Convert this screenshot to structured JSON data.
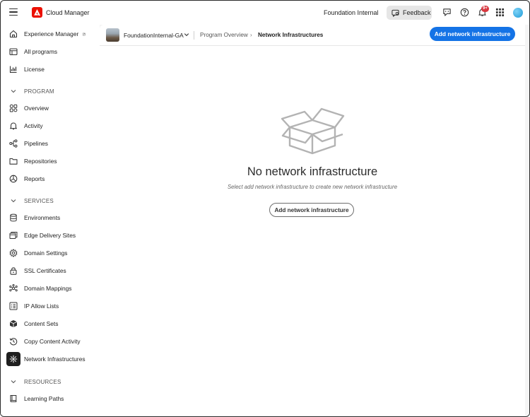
{
  "app": {
    "title": "Cloud Manager",
    "org_name": "Foundation Internal",
    "feedback_label": "Feedback",
    "notification_count": "9+",
    "brand_color": "#eb1000",
    "accent_color": "#1473e6"
  },
  "sidebar": {
    "top_items": [
      {
        "label": "Experience Manager",
        "icon": "home-icon"
      },
      {
        "label": "All programs",
        "icon": "programs-icon"
      },
      {
        "label": "License",
        "icon": "license-icon"
      }
    ],
    "sections": [
      {
        "title": "PROGRAM",
        "items": [
          {
            "label": "Overview",
            "icon": "overview-icon"
          },
          {
            "label": "Activity",
            "icon": "bell-icon"
          },
          {
            "label": "Pipelines",
            "icon": "pipelines-icon"
          },
          {
            "label": "Repositories",
            "icon": "folder-icon"
          },
          {
            "label": "Reports",
            "icon": "pie-chart-icon"
          }
        ]
      },
      {
        "title": "SERVICES",
        "items": [
          {
            "label": "Environments",
            "icon": "database-icon"
          },
          {
            "label": "Edge Delivery Sites",
            "icon": "sites-icon"
          },
          {
            "label": "Domain Settings",
            "icon": "settings-icon"
          },
          {
            "label": "SSL Certificates",
            "icon": "lock-icon"
          },
          {
            "label": "Domain Mappings",
            "icon": "mapping-icon"
          },
          {
            "label": "IP Allow Lists",
            "icon": "list-icon"
          },
          {
            "label": "Content Sets",
            "icon": "boxes-icon"
          },
          {
            "label": "Copy Content Activity",
            "icon": "history-icon"
          },
          {
            "label": "Network Infrastructures",
            "icon": "network-icon",
            "active": true
          }
        ]
      },
      {
        "title": "RESOURCES",
        "items": [
          {
            "label": "Learning Paths",
            "icon": "book-icon"
          }
        ]
      }
    ]
  },
  "header": {
    "program_name": "FoundationInternal-GA",
    "breadcrumb": [
      "Program Overview",
      "Network Infrastructures"
    ],
    "breadcrumb_separator": "›",
    "primary_action": "Add network infrastructure"
  },
  "empty_state": {
    "title": "No network infrastructure",
    "subtitle": "Select add network infrastructure to create new network infrastructure",
    "action_label": "Add network infrastructure"
  }
}
